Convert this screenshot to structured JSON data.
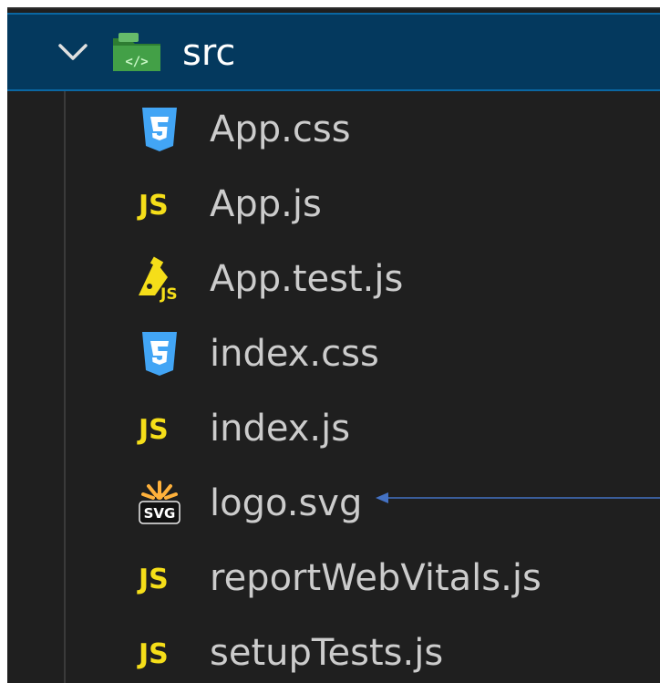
{
  "explorer": {
    "folder": {
      "name": "src",
      "expanded": true,
      "chevron_icon": "chevron-down-icon",
      "icon": "folder-source-icon"
    },
    "files": [
      {
        "label": "App.css",
        "icon": "css-icon",
        "color": "#42a5f5"
      },
      {
        "label": "App.js",
        "icon": "javascript-icon",
        "color": "#f5de19"
      },
      {
        "label": "App.test.js",
        "icon": "test-js-icon",
        "color": "#f5de19"
      },
      {
        "label": "index.css",
        "icon": "css-icon",
        "color": "#42a5f5"
      },
      {
        "label": "index.js",
        "icon": "javascript-icon",
        "color": "#f5de19"
      },
      {
        "label": "logo.svg",
        "icon": "svg-icon",
        "color": "#ffb13b"
      },
      {
        "label": "reportWebVitals.js",
        "icon": "javascript-icon",
        "color": "#f5de19"
      },
      {
        "label": "setupTests.js",
        "icon": "javascript-icon",
        "color": "#f5de19"
      }
    ],
    "annotation": {
      "target": "logo.svg",
      "icon": "arrow-left-icon",
      "color": "#4472c4"
    }
  },
  "colors": {
    "background": "#1f1f1f",
    "selection": "#04395e",
    "selection_border": "#0a67a3",
    "text": "#cccccc"
  }
}
